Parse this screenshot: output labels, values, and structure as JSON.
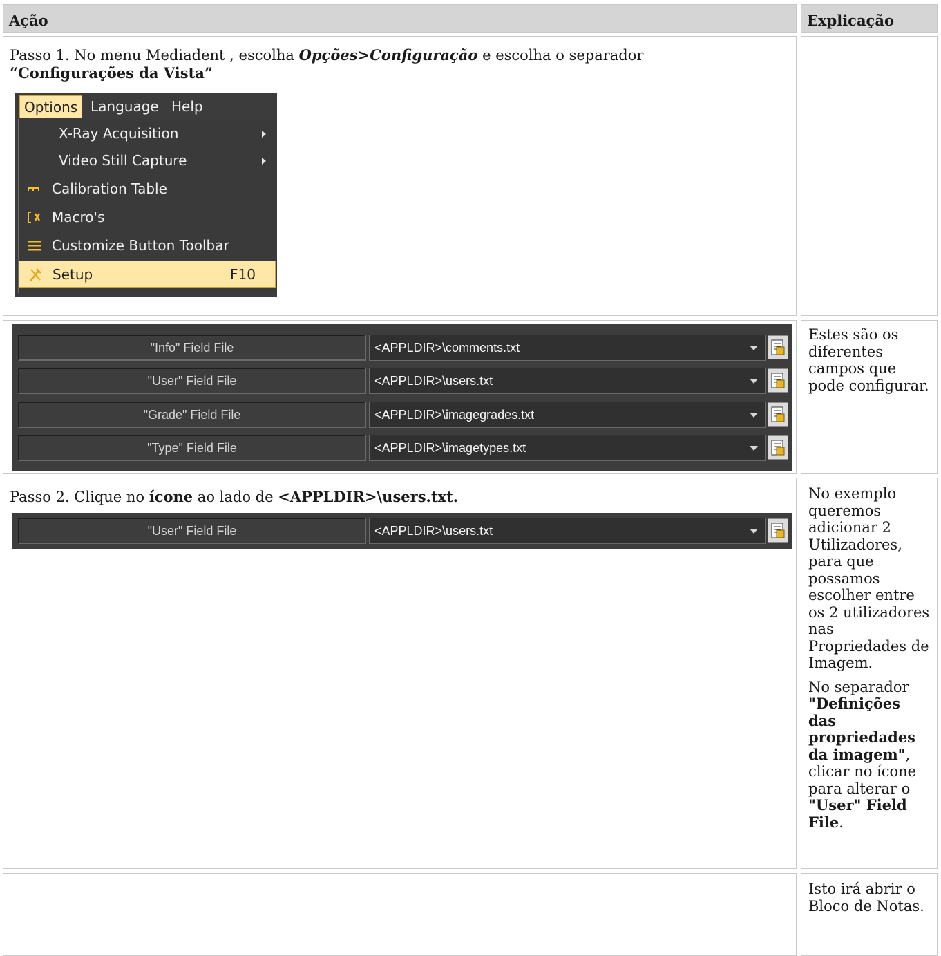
{
  "header": {
    "action": "Ação",
    "explanation": "Explicação"
  },
  "row1": {
    "step_prefix": "Passo 1. No menu Mediadent , escolha ",
    "step_menu_path": "Opções>Configuração",
    "step_suffix": " e escolha o separador",
    "step_tab": "“Configurações da Vista”",
    "menu": {
      "bar": [
        "Options",
        "Language",
        "Help"
      ],
      "items": [
        {
          "label": "X-Ray Acquisition",
          "icon": "none",
          "submenu": true
        },
        {
          "label": "Video Still Capture",
          "icon": "none",
          "submenu": true
        },
        {
          "label": "Calibration Table",
          "icon": "ruler-icon",
          "submenu": false
        },
        {
          "label": "Macro's",
          "icon": "macro-icon",
          "submenu": false
        },
        {
          "label": "Customize Button Toolbar",
          "icon": "list-icon",
          "submenu": false
        },
        {
          "label": "Setup",
          "icon": "tools-icon",
          "shortcut": "F10",
          "highlighted": true
        }
      ]
    }
  },
  "row2": {
    "fields": [
      {
        "label": "\"Info\" Field File",
        "value": "<APPLDIR>\\comments.txt"
      },
      {
        "label": "\"User\" Field File",
        "value": "<APPLDIR>\\users.txt"
      },
      {
        "label": "\"Grade\" Field File",
        "value": "<APPLDIR>\\imagegrades.txt"
      },
      {
        "label": "\"Type\" Field File",
        "value": "<APPLDIR>\\imagetypes.txt"
      }
    ],
    "explanation": "Estes são os diferentes campos que pode configurar."
  },
  "row3": {
    "step_prefix": "Passo 2. Clique no ",
    "step_icon_word": "ícone",
    "step_mid": " ao lado de ",
    "step_path": "<APPLDIR>\\users.txt.",
    "field": {
      "label": "\"User\" Field File",
      "value": "<APPLDIR>\\users.txt"
    },
    "explanation_p1": "No exemplo queremos adicionar 2 Utilizadores, para que possamos escolher entre os 2 utilizadores nas Propriedades de Imagem.",
    "explanation_p2_prefix": "No separador ",
    "explanation_p2_tab": "\"Definições das propriedades da imagem\"",
    "explanation_p2_mid": ", clicar no ícone para alterar o ",
    "explanation_p2_field": "\"User\" Field File",
    "explanation_p2_end": "."
  },
  "row4": {
    "explanation": "Isto irá abrir o Bloco de Notas."
  }
}
